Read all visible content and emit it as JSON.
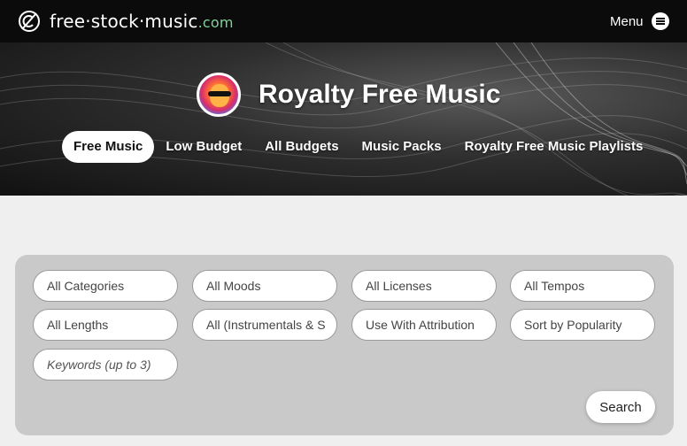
{
  "header": {
    "logo_text_main": "free·stock·music",
    "logo_text_tld": ".com",
    "menu_label": "Menu",
    "icons": {
      "logo": "no-copyright-icon",
      "menu": "hamburger-circle-icon"
    }
  },
  "hero": {
    "title": "Royalty Free Music",
    "tabs": [
      {
        "label": "Free Music",
        "active": true
      },
      {
        "label": "Low Budget",
        "active": false
      },
      {
        "label": "All Budgets",
        "active": false
      },
      {
        "label": "Music Packs",
        "active": false
      },
      {
        "label": "Royalty Free Music Playlists",
        "active": false
      }
    ]
  },
  "filters": {
    "categories": "All Categories",
    "moods": "All Moods",
    "licenses": "All Licenses",
    "tempos": "All Tempos",
    "lengths": "All Lengths",
    "instrumentals": "All (Instrumentals & S",
    "attribution": "Use With Attribution",
    "sort": "Sort by Popularity",
    "keywords_placeholder": "Keywords (up to 3)",
    "search_label": "Search"
  },
  "colors": {
    "topbar": "#0b0b0b",
    "tld": "#7fd39a",
    "panel": "#c9c9c9",
    "page_bg": "#efefef"
  }
}
